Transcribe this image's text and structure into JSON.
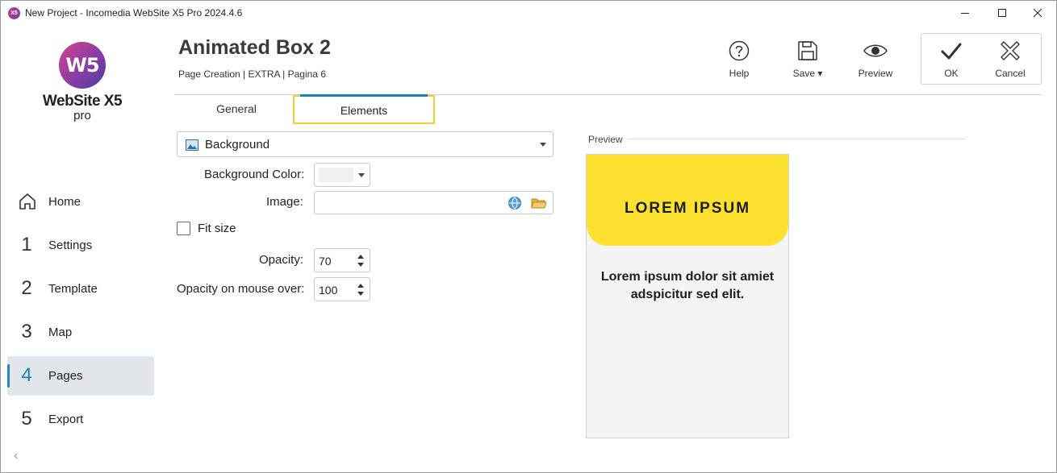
{
  "window": {
    "title": "New Project - Incomedia WebSite X5 Pro 2024.4.6",
    "icon_text": "X5"
  },
  "logo": {
    "mark": "W5",
    "name": "WebSite X5",
    "edition": "pro"
  },
  "sidebar": {
    "items": [
      {
        "num": "",
        "label": "Home",
        "icon": "home-icon"
      },
      {
        "num": "1",
        "label": "Settings"
      },
      {
        "num": "2",
        "label": "Template"
      },
      {
        "num": "3",
        "label": "Map"
      },
      {
        "num": "4",
        "label": "Pages",
        "active": true
      },
      {
        "num": "5",
        "label": "Export"
      }
    ],
    "collapse_glyph": "‹"
  },
  "header": {
    "title": "Animated Box 2",
    "breadcrumb": "Page Creation | EXTRA | Pagina 6"
  },
  "toolbar": {
    "help": "Help",
    "save": "Save ▾",
    "preview": "Preview",
    "ok": "OK",
    "cancel": "Cancel"
  },
  "tabs": {
    "general": "General",
    "elements": "Elements",
    "active": "Elements"
  },
  "form": {
    "section_select": "Background",
    "background_color_label": "Background Color:",
    "background_color_value": "#f0f0f0",
    "image_label": "Image:",
    "image_value": "",
    "fit_size_label": "Fit size",
    "fit_size_checked": false,
    "opacity_label": "Opacity:",
    "opacity_value": "70",
    "opacity_hover_label": "Opacity on mouse over:",
    "opacity_hover_value": "100"
  },
  "preview": {
    "label": "Preview",
    "box_title": "LOREM IPSUM",
    "box_text": "Lorem ipsum dolor sit amiet adspicitur sed elit.",
    "accent_color": "#fde12f"
  },
  "colors": {
    "accent_blue": "#1a83bd",
    "highlight_yellow": "#f2cc2f",
    "active_nav_bg": "#e1e6ea"
  }
}
